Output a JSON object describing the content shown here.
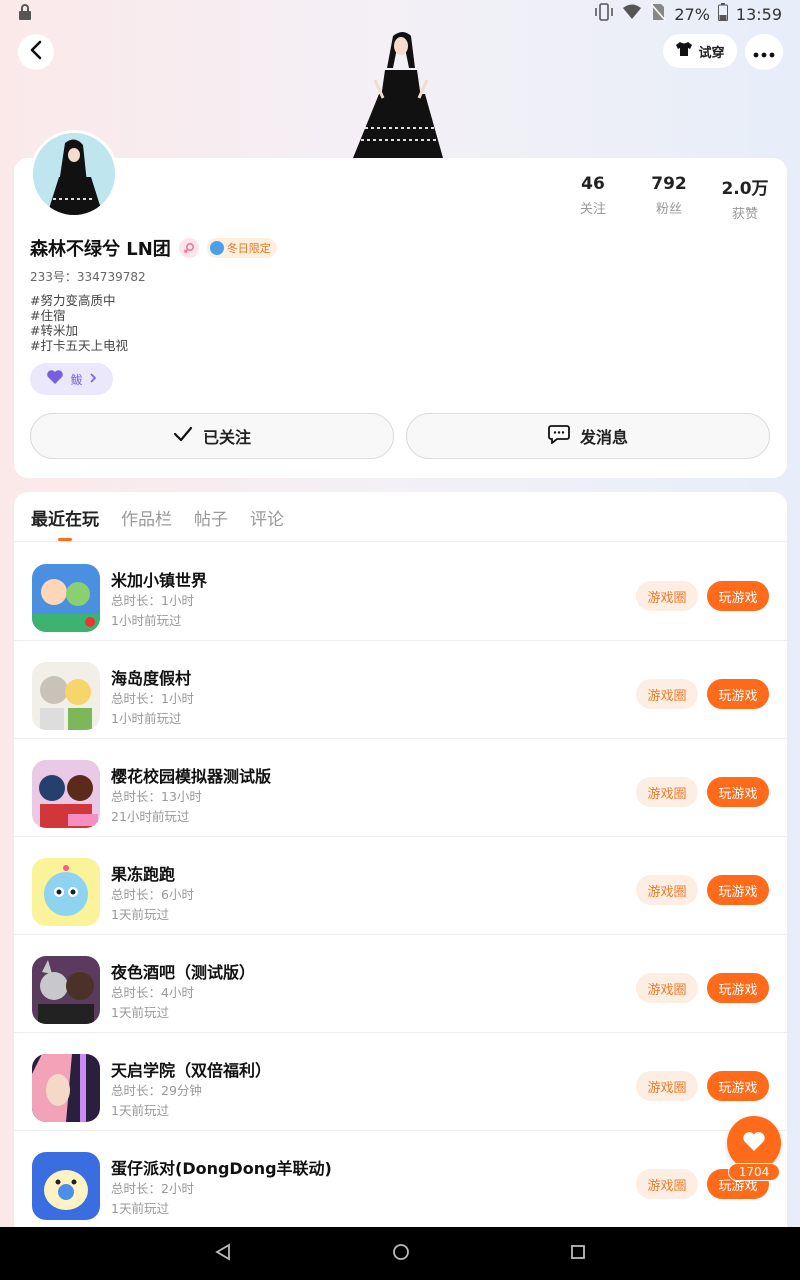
{
  "status": {
    "battery": "27%",
    "time": "13:59"
  },
  "header": {
    "tryon_label": "试穿"
  },
  "profile": {
    "name": "森林不绿兮 LN团",
    "badge_label": "冬日限定",
    "uid": "233号：334739782",
    "bio": [
      "#努力变高质中",
      "#住宿",
      "#转米加",
      "#打卡五天上电视"
    ],
    "tag_chip_label": "鲅",
    "stats": [
      {
        "value": "46",
        "label": "关注"
      },
      {
        "value": "792",
        "label": "粉丝"
      },
      {
        "value": "2.0万",
        "label": "获赞"
      }
    ],
    "follow_label": "已关注",
    "message_label": "发消息"
  },
  "tabs": [
    {
      "label": "最近在玩",
      "active": true
    },
    {
      "label": "作品栏",
      "active": false
    },
    {
      "label": "帖子",
      "active": false
    },
    {
      "label": "评论",
      "active": false
    }
  ],
  "games": [
    {
      "title": "米加小镇世界",
      "duration": "总时长：1小时",
      "last_played": "1小时前玩过"
    },
    {
      "title": "海岛度假村",
      "duration": "总时长：1小时",
      "last_played": "1小时前玩过"
    },
    {
      "title": "樱花校园模拟器测试版",
      "duration": "总时长：13小时",
      "last_played": "21小时前玩过"
    },
    {
      "title": "果冻跑跑",
      "duration": "总时长：6小时",
      "last_played": "1天前玩过"
    },
    {
      "title": "夜色酒吧（测试版）",
      "duration": "总时长：4小时",
      "last_played": "1天前玩过"
    },
    {
      "title": "天启学院（双倍福利）",
      "duration": "总时长：29分钟",
      "last_played": "1天前玩过"
    },
    {
      "title": "蛋仔派对(DongDong羊联动)",
      "duration": "总时长：2小时",
      "last_played": "1天前玩过"
    }
  ],
  "game_buttons": {
    "circle_label": "游戏圈",
    "play_label": "玩游戏"
  },
  "like_count": "1704"
}
